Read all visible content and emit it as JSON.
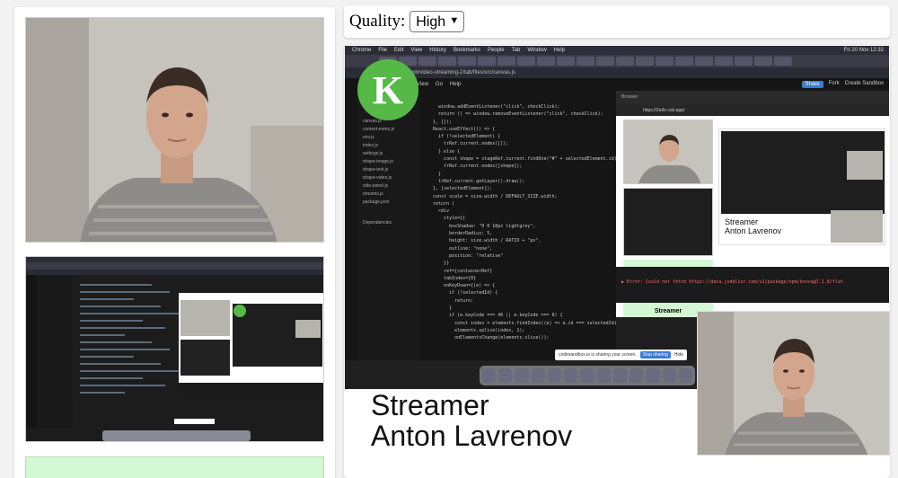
{
  "toolbar": {
    "quality_label": "Quality:",
    "quality_value": "High",
    "quality_options": [
      "High"
    ]
  },
  "streamer": {
    "title": "Streamer",
    "name": "Anton Lavrenov"
  },
  "shared_screen": {
    "menu": [
      "Chrome",
      "File",
      "Edit",
      "View",
      "History",
      "Bookmarks",
      "People",
      "Tab",
      "Window",
      "Help"
    ],
    "clock": "Fri 20 Nov 12:32",
    "url": "...pb/video-streaming-2/tab/files/src/canvas.js",
    "app_menu": [
      "View",
      "Go",
      "Help"
    ],
    "share_label": "Share",
    "fork_label": "Fork",
    "create_label": "Create Sandbox",
    "files": [
      "canvas.js",
      "context-menu.js",
      "env.js",
      "index.js",
      "settings.js",
      "shape-image.js",
      "shape-text.js",
      "shape-video.js",
      "side-panel.js",
      "streams.js",
      "package.json"
    ],
    "dependencies_label": "Dependencies",
    "code_lines": [
      "    window.addEventListener(\"click\", checkClick);",
      "    return () => window.removeEventListener(\"click\", checkClick);",
      "  }, []);",
      "",
      "  React.useEffect(() => {",
      "    if (!selectedElement) {",
      "      trRef.current.nodes([]);",
      "    } else {",
      "      const shape = stageRef.current.findOne(\"#\" + selectedElement.id);",
      "      trRef.current.nodes([shape]);",
      "    }",
      "    trRef.current.getLayer().draw();",
      "  }, [selectedElement]);",
      "",
      "  const scale = size.width / DEFAULT_SIZE.width;",
      "",
      "  return (",
      "    <div",
      "      style={{",
      "        boxShadow: \"0 0 10px lightgrey\",",
      "        borderRadius: 5,",
      "        height: size.width / RATIO + \"px\",",
      "        outline: \"none\",",
      "        position: \"relative\"",
      "      }}",
      "      ref={containerRef}",
      "      tabIndex={0}",
      "      onKeyDown={(e) => {",
      "        if (!selectedId) {",
      "          return;",
      "        }",
      "        if (e.keyCode === 46 || e.keyCode === 8) {",
      "          const index = elements.findIndex((e) => e.id === selectedId);",
      "          elements.splice(index, 1);",
      "          onElementsChange(elements.slice());"
    ],
    "browser_tab": "Browser",
    "preview_url": "https://2a4z-csb.app/",
    "console_error": "▶ Error: Could not fetch https://data.jsdelivr.com/v1/package/npm/konva@7.1.8/flat",
    "sharing_text": "codesandbox.io is sharing your screen.",
    "stop_sharing": "Stop sharing",
    "hide": "Hide",
    "logo_letter": "K"
  },
  "colors": {
    "green_tile": "#d4f7d4",
    "logo_green": "#56b947",
    "code_bg": "#151515"
  }
}
